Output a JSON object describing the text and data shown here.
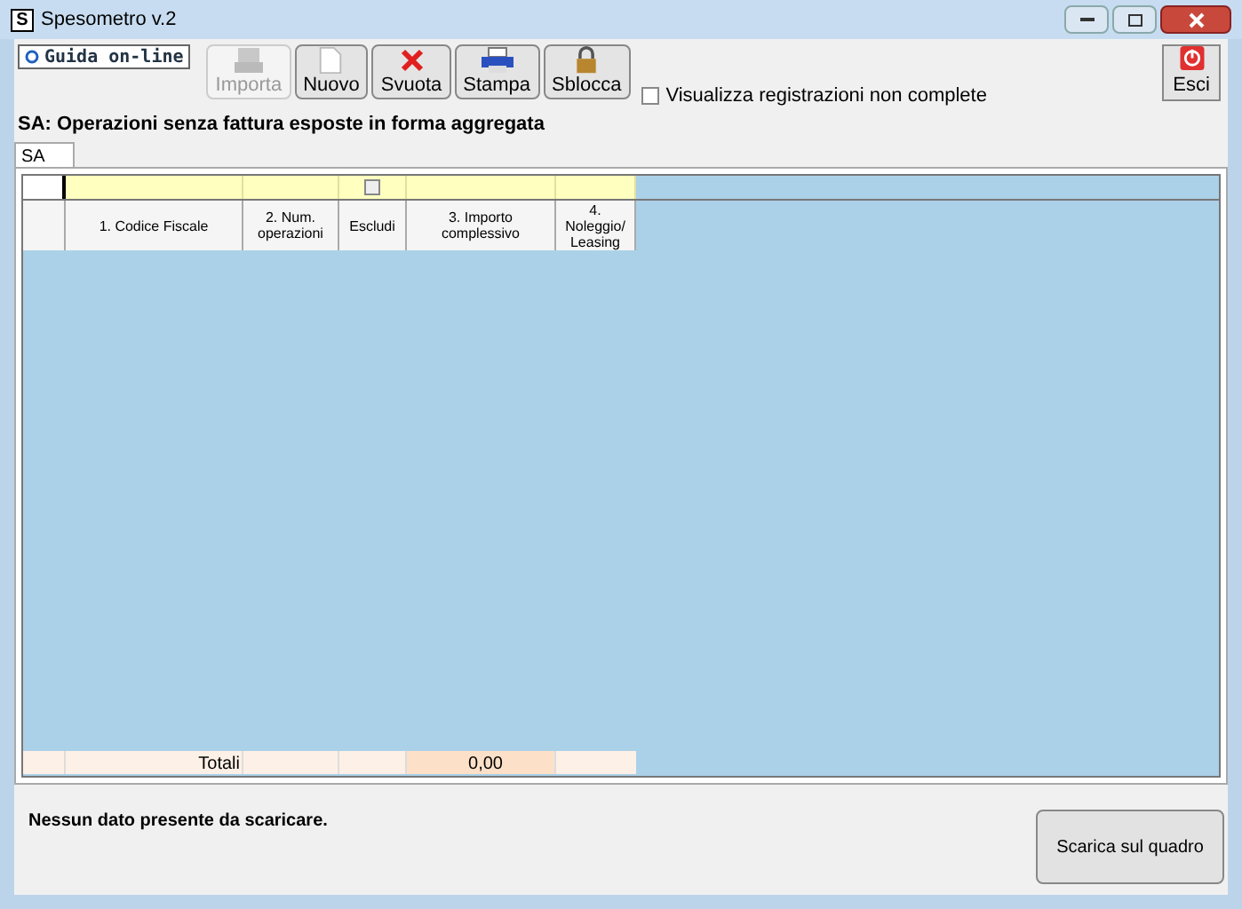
{
  "window": {
    "title": "Spesometro v.2",
    "app_icon": "S"
  },
  "help_link": {
    "label": "Guida on-line"
  },
  "toolbar": [
    {
      "label": "Importa",
      "kind": "import",
      "disabled": true
    },
    {
      "label": "Nuovo",
      "kind": "new",
      "disabled": false
    },
    {
      "label": "Svuota",
      "kind": "clear",
      "disabled": false
    },
    {
      "label": "Stampa",
      "kind": "print",
      "disabled": false
    },
    {
      "label": "Sblocca",
      "kind": "unlock",
      "disabled": false
    }
  ],
  "show_incomplete": {
    "label": "Visualizza registrazioni non complete",
    "checked": false
  },
  "exit_button": {
    "label": "Esci"
  },
  "heading": "SA: Operazioni senza fattura esposte in forma aggregata",
  "tabs": [
    {
      "label": "SA",
      "selected": true
    }
  ],
  "table": {
    "columns": [
      "1. Codice Fiscale",
      "2. Num. operazioni",
      "Escludi",
      "3. Importo complessivo",
      "4. Noleggio/ Leasing"
    ],
    "exclude_all": {
      "checked": false
    },
    "totals": {
      "label": "Totali",
      "importo": "0,00"
    }
  },
  "status": "Nessun dato presente da scaricare.",
  "action_button": {
    "label": "Scarica sul quadro"
  }
}
